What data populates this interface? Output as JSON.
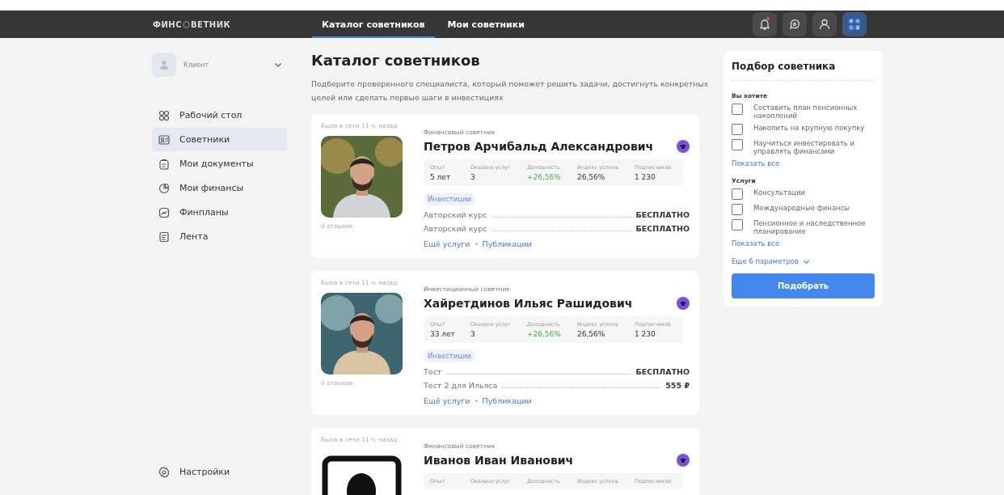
{
  "header": {
    "logo": {
      "before": "ФИНС",
      "after": "ВЕТНИК"
    },
    "tabs": [
      {
        "label": "Каталог советников",
        "selected": true
      },
      {
        "label": "Мои советники",
        "selected": false
      }
    ],
    "actions": [
      {
        "kind": "bell",
        "notification": true
      },
      {
        "kind": "chat",
        "notification": false
      },
      {
        "kind": "user",
        "notification": false
      },
      {
        "kind": "calculator",
        "notification": false
      }
    ]
  },
  "sidebar": {
    "profile": {
      "role": "Клиент"
    },
    "items": [
      {
        "kind": "dashboard",
        "label": "Рабочий стол",
        "selected": false
      },
      {
        "kind": "advisors",
        "label": "Советники",
        "selected": true
      },
      {
        "kind": "documents",
        "label": "Мои документы",
        "selected": false
      },
      {
        "kind": "finance",
        "label": "Мои финансы",
        "selected": false
      },
      {
        "kind": "plans",
        "label": "Финпланы",
        "selected": false
      },
      {
        "kind": "feed",
        "label": "Лента",
        "selected": false
      }
    ],
    "settings": "Настройки"
  },
  "main": {
    "title": "Каталог советников",
    "subtitle": "Подберите проверенного специалиста, который поможет решить задачи, достигнуть конкретных целей или сделать первые шаги в инвестициях",
    "advisors": [
      {
        "last_seen": "Была в сети 11 ч. назад",
        "photo": {
          "kind": "picture"
        },
        "reviews": "0 отзывов",
        "role": "Финансовый советник",
        "name": "Петров Арчибальд Александрович",
        "stats": [
          {
            "label": "Опыт",
            "value": "5 лет",
            "kind": "plain"
          },
          {
            "label": "Оказано услуг",
            "value": "3",
            "kind": "plain"
          },
          {
            "label": "Доходность",
            "value": "+26,56%",
            "kind": "gain"
          },
          {
            "label": "Индекс успеха",
            "value": "26,56%",
            "kind": "plain"
          },
          {
            "label": "Подписчиков",
            "value": "1 230",
            "kind": "plain"
          }
        ],
        "tags": [
          "Инвестиции"
        ],
        "services": [
          {
            "name": "Авторский курс",
            "price": "БЕСПЛАТНО"
          },
          {
            "name": "Авторский курс",
            "price": "БЕСПЛАТНО"
          }
        ],
        "links": [
          "Ещё услуги",
          "Публикации"
        ]
      },
      {
        "last_seen": "Была в сети 11 ч. назад",
        "photo": {
          "kind": "picture"
        },
        "reviews": "0 отзывов",
        "role": "Инвестиционный советник",
        "name": "Хайретдинов Ильяс Рашидович",
        "stats": [
          {
            "label": "Опыт",
            "value": "33 лет",
            "kind": "plain"
          },
          {
            "label": "Оказано услуг",
            "value": "3",
            "kind": "plain"
          },
          {
            "label": "Доходность",
            "value": "+26,56%",
            "kind": "gain"
          },
          {
            "label": "Индекс успеха",
            "value": "26,56%",
            "kind": "plain"
          },
          {
            "label": "Подписчиков",
            "value": "1 230",
            "kind": "plain"
          }
        ],
        "tags": [
          "Инвестиции"
        ],
        "services": [
          {
            "name": "Тест",
            "price": "БЕСПЛАТНО"
          },
          {
            "name": "Тест 2 для Ильяса",
            "price": "555 ₽"
          }
        ],
        "links": [
          "Ещё услуги",
          "Публикации"
        ]
      },
      {
        "last_seen": "Была в сети 11 ч. назад",
        "photo": {
          "kind": "placeholder"
        },
        "role": "Финансовый советник",
        "name": "Иванов Иван Иванович",
        "stats": [
          {
            "label": "Опыт"
          },
          {
            "label": "Оказано услуг"
          },
          {
            "label": "Доходность"
          },
          {
            "label": "Индекс успеха"
          },
          {
            "label": "Подписчиков"
          }
        ]
      }
    ]
  },
  "filter": {
    "title": "Подбор советника",
    "groups": [
      {
        "title": "Вы хотите",
        "options": [
          {
            "label": "Составить план пенсионных накоплений",
            "checked": false
          },
          {
            "label": "Накопить на крупную покупку",
            "checked": false
          },
          {
            "label": "Научиться инвестировать и управлять финансами",
            "checked": false
          }
        ],
        "show_all": "Показать все"
      },
      {
        "title": "Услуги",
        "options": [
          {
            "label": "Консультации",
            "checked": false
          },
          {
            "label": "Международные финансы",
            "checked": false
          },
          {
            "label": "Пенсионное и наследственное планирование",
            "checked": false
          }
        ],
        "show_all": "Показать все"
      }
    ],
    "more": "Еще 6 параметров",
    "button": "Подобрать"
  }
}
